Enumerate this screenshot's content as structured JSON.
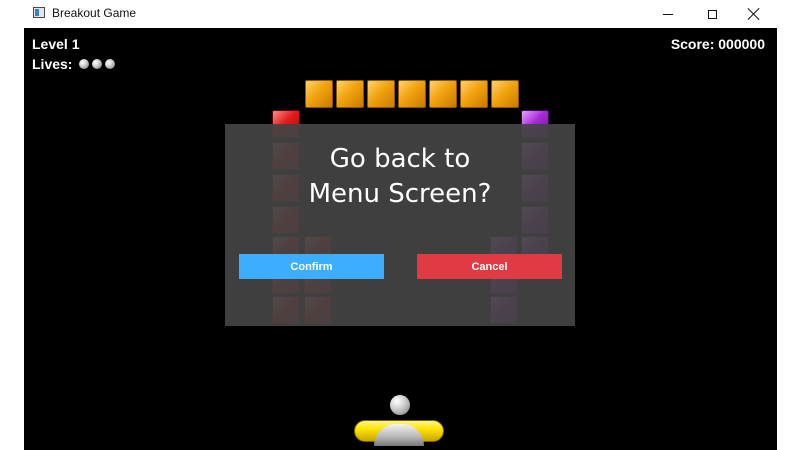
{
  "window": {
    "title": "Breakout Game",
    "icon": "app-window-icon",
    "controls": [
      "minimize-icon",
      "maximize-icon",
      "close-icon"
    ]
  },
  "hud": {
    "level": "Level 1",
    "lives_label": "Lives:",
    "lives_count": 3,
    "score": "Score: 000000"
  },
  "bricks": {
    "top_row": {
      "color": "orange",
      "count": 7
    },
    "left_column": {
      "color": "red"
    },
    "right_column": {
      "color": "purple"
    }
  },
  "dialog": {
    "message_line1": "Go back to",
    "message_line2": "Menu Screen?",
    "confirm_label": "Confirm",
    "cancel_label": "Cancel"
  },
  "colors": {
    "confirm": "#3daeff",
    "cancel": "#e03a45",
    "dialog_bg": "#444444",
    "brick_orange": "#f2a30f",
    "brick_red": "#e41b1b",
    "brick_purple": "#a82bd6",
    "paddle": "#ffe400"
  }
}
